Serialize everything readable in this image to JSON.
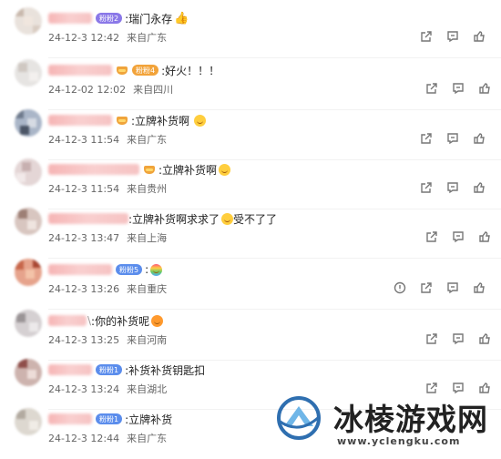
{
  "comments": [
    {
      "text": ":瑞门永存",
      "badge": "粉粉2",
      "badge_style": "purple",
      "emoji": "thumbs-up",
      "time": "24-12-3 12:42",
      "location": "来自广东"
    },
    {
      "text": ":好火！！！",
      "badge": "粉粉4",
      "badge_style": "orange",
      "emoji": "",
      "time": "24-12-02 12:02",
      "location": "来自四川"
    },
    {
      "text": ":立牌补货啊",
      "badge": "",
      "badge_style": "crown",
      "emoji": "smile",
      "time": "24-12-3 11:54",
      "location": "来自广东"
    },
    {
      "text": ":立牌补货啊",
      "badge": "",
      "badge_style": "crown",
      "emoji": "smile",
      "time": "24-12-3 11:54",
      "location": "来自贵州"
    },
    {
      "text": ":立牌补货啊求求了",
      "emoji": "crying",
      "extra": "受不了了",
      "badge": "",
      "badge_style": "none",
      "time": "24-12-3 13:47",
      "location": "来自上海"
    },
    {
      "text": ":",
      "badge": "粉粉5",
      "badge_style": "blue",
      "emoji": "rainbow",
      "time": "24-12-3 13:26",
      "location": "来自重庆"
    },
    {
      "text": ":你的补货呢",
      "badge": "",
      "badge_style": "none",
      "emoji": "grin",
      "time": "24-12-3 13:25",
      "location": "来自河南"
    },
    {
      "text": ":补货补货钥匙扣",
      "badge": "粉粉1",
      "badge_style": "blue",
      "emoji": "",
      "time": "24-12-3 13:24",
      "location": "来自湖北"
    },
    {
      "text": ":立牌补货",
      "badge": "粉粉1",
      "badge_style": "blue",
      "emoji": "",
      "time": "24-12-3 12:44",
      "location": "来自广东"
    }
  ],
  "watermark": {
    "title": "冰棱游戏网",
    "url": "www.yclengku.com"
  },
  "colors": {
    "accent": "#5b8dec",
    "badge_purple": "#8a78e8",
    "crown": "#f0a43b"
  }
}
